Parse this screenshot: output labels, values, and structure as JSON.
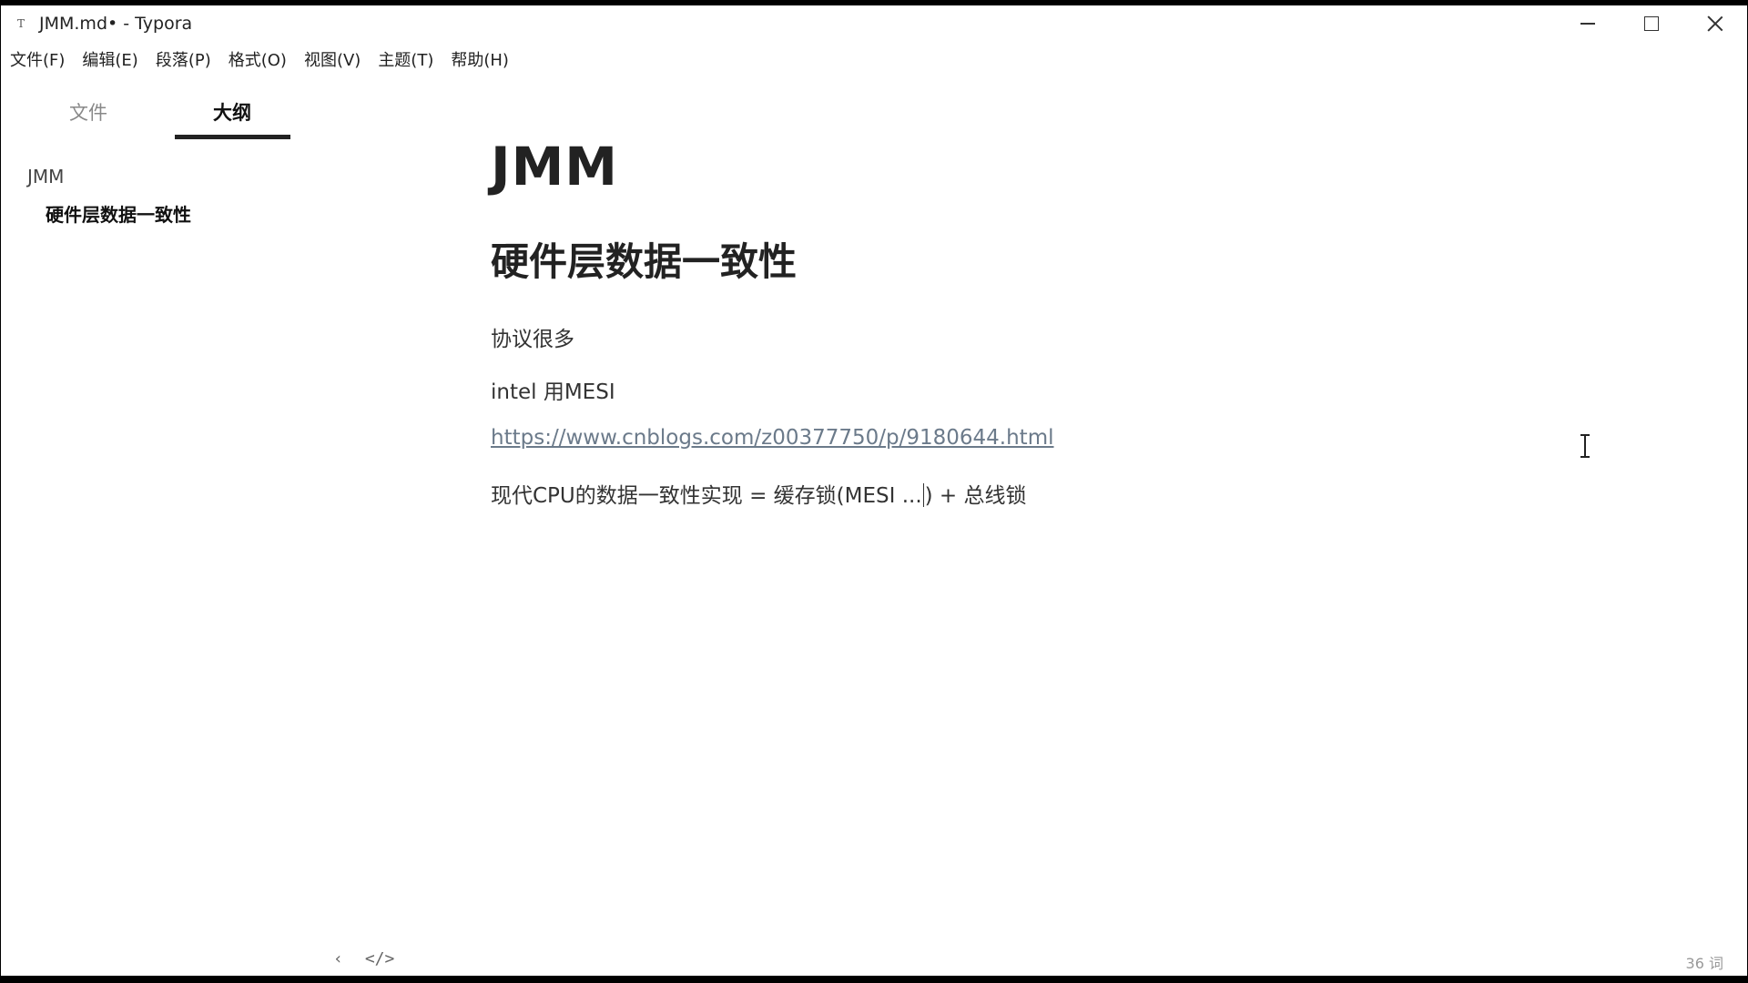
{
  "window": {
    "title": "JMM.md• - Typora",
    "app_icon": "T"
  },
  "menu": [
    "文件(F)",
    "编辑(E)",
    "段落(P)",
    "格式(O)",
    "视图(V)",
    "主题(T)",
    "帮助(H)"
  ],
  "sidebar": {
    "tabs": {
      "files": "文件",
      "outline": "大纲"
    },
    "active_tab": "outline",
    "outline": {
      "h1": "JMM",
      "h2": "硬件层数据一致性"
    }
  },
  "document": {
    "h1": "JMM",
    "h2": "硬件层数据一致性",
    "p1": "协议很多",
    "p2": "intel 用MESI",
    "link": "https://www.cnblogs.com/z00377750/p/9180644.html",
    "p4_before_caret": "现代CPU的数据一致性实现 = 缓存锁(MESI ...",
    "p4_after_caret": ") + 总线锁"
  },
  "status": {
    "back_icon": "‹",
    "source_icon": "</>",
    "word_count": "36 词"
  },
  "icons": {
    "minimize": "minimize-icon",
    "maximize": "maximize-icon",
    "close": "close-icon",
    "cursor": "text-cursor-icon"
  }
}
